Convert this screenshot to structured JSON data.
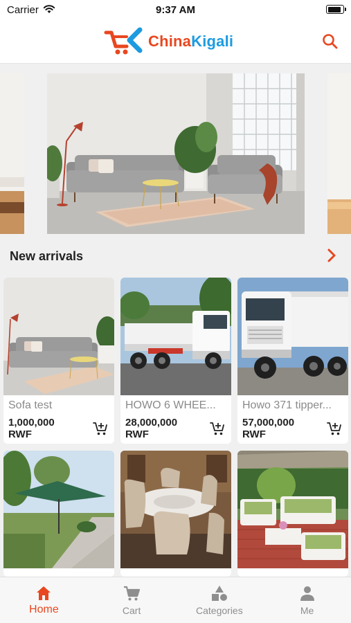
{
  "status_bar": {
    "carrier": "Carrier",
    "time": "9:37 AM",
    "battery_level": 0.9
  },
  "header": {
    "logo_part1": "China",
    "logo_part2": "Kigali",
    "brand_colors": {
      "orange": "#e8471f",
      "blue": "#1d9be0"
    },
    "search_icon": "search-icon"
  },
  "banner": {
    "images": [
      "living-room-side",
      "living-room-sofa",
      "living-room-side"
    ]
  },
  "new_arrivals": {
    "title": "New arrivals",
    "more_icon": "chevron-right-icon"
  },
  "products": [
    {
      "name": "Sofa test",
      "price": "1,000,000",
      "currency": "RWF",
      "image": "sofa"
    },
    {
      "name": "HOWO 6 WHEE...",
      "price": "28,000,000",
      "currency": "RWF",
      "image": "dump-truck-small"
    },
    {
      "name": "Howo 371 tipper...",
      "price": "57,000,000",
      "currency": "RWF",
      "image": "tipper-truck"
    },
    {
      "name": "",
      "price": "",
      "currency": "",
      "image": "garden-umbrella"
    },
    {
      "name": "",
      "price": "",
      "currency": "",
      "image": "dining-set"
    },
    {
      "name": "",
      "price": "",
      "currency": "",
      "image": "outdoor-sofa"
    }
  ],
  "tabs": [
    {
      "label": "Home",
      "icon": "home-icon",
      "active": true
    },
    {
      "label": "Cart",
      "icon": "cart-icon",
      "active": false
    },
    {
      "label": "Categories",
      "icon": "categories-icon",
      "active": false
    },
    {
      "label": "Me",
      "icon": "person-icon",
      "active": false
    }
  ]
}
